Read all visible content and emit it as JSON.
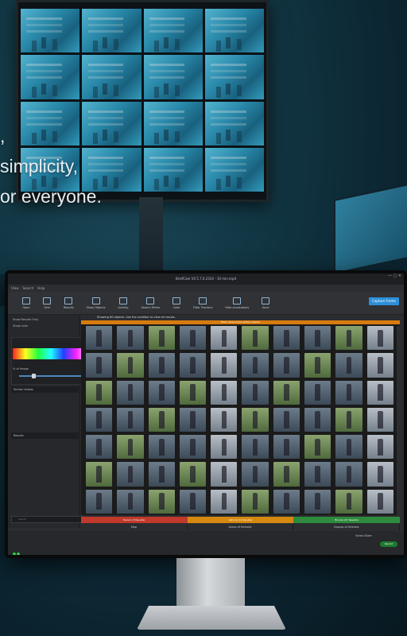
{
  "tagline": {
    "line1": ",",
    "line2": "simplicity,",
    "line3": "or everyone."
  },
  "app": {
    "title": "BriefCam VS 5.7.0.2314 - 10 min.mp4",
    "menu": [
      "View",
      "Search",
      "Help"
    ],
    "toolbar": [
      "Open",
      "Grid",
      "Results",
      "Show Objects",
      "Activity",
      "Search Filters",
      "Color",
      "Filter Trackers",
      "Hide annotations",
      "Save"
    ],
    "capture_button": "Capture Frame",
    "notice": "Showing 60 objects. Use the scrollbar to view all results.",
    "filter_bar": "Filter: Show more similar objects",
    "sidebar": {
      "filters_label": "Show Results Only",
      "color_label": "Show color",
      "brightness": "% of image",
      "section1": "Similar Videos",
      "section2": "Results",
      "search_placeholder": "Search"
    },
    "status_segments": [
      {
        "label": "Person (3 Results)",
        "color": "#c0392b"
      },
      {
        "label": "Vehicle (12 Results)",
        "color": "#d68910"
      },
      {
        "label": "Bicycle (47 Results)",
        "color": "#2e8b3e"
      }
    ],
    "bottom_tabs": [
      "Map",
      "Areas of Interest",
      "Groups of Interest"
    ],
    "video_slider": "Video Slider",
    "record_label": "Record"
  }
}
